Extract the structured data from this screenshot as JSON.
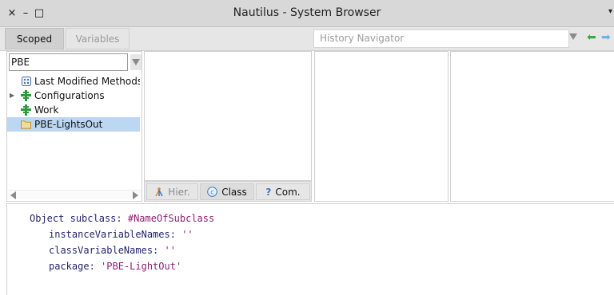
{
  "window": {
    "close_glyph": "×",
    "minimize_glyph": "–",
    "maximize_glyph": "□",
    "title": "Nautilus - System Browser",
    "menu_glyph": "▾"
  },
  "toolbar": {
    "scoped_label": "Scoped",
    "variables_label": "Variables",
    "history_placeholder": "History Navigator",
    "back_glyph": "⬅",
    "forward_glyph": "➡"
  },
  "package_pane": {
    "filter_value": "PBE",
    "items": [
      {
        "label": "Last Modified Methods",
        "icon": "grid-icon",
        "expandable": false,
        "selected": false
      },
      {
        "label": "Configurations",
        "icon": "configuration-icon",
        "expandable": true,
        "selected": false
      },
      {
        "label": "Work",
        "icon": "configuration-icon",
        "expandable": false,
        "selected": false
      },
      {
        "label": "PBE-LightsOut",
        "icon": "folder-icon",
        "expandable": false,
        "selected": true
      }
    ]
  },
  "class_tabs": {
    "hier_label": "Hier.",
    "class_label": "Class",
    "comment_label": "Com.",
    "comment_glyph": "?"
  },
  "editor": {
    "line1_receiver": "Object",
    "line1_selector": "subclass:",
    "line1_symbol": "#NameOfSubclass",
    "line2_selector": "instanceVariableNames:",
    "line2_value": "''",
    "line3_selector": "classVariableNames:",
    "line3_value": "''",
    "line4_selector": "package:",
    "line4_value": "'PBE-LightOut'"
  },
  "colors": {
    "selection": "#bcd7f2",
    "code_keyword": "#22256b",
    "code_literal": "#8b1f76",
    "back_arrow": "#3aaa44",
    "forward_arrow": "#6ab4e8",
    "config_icon": "#2e9a3e",
    "folder_icon": "#c08a2a"
  }
}
